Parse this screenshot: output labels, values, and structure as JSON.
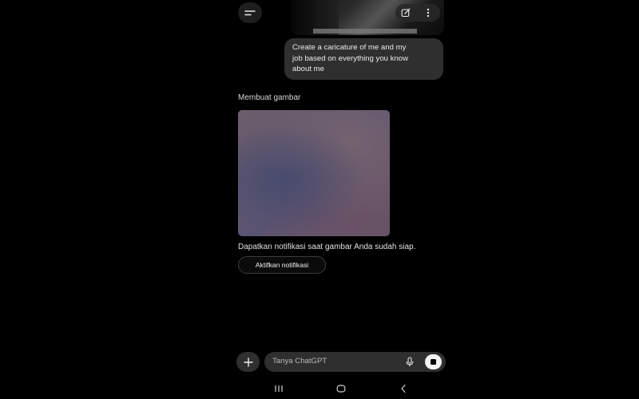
{
  "header": {
    "menu_icon": "menu-icon"
  },
  "user_message": {
    "image_actions": {
      "edit_icon": "edit-icon",
      "more_icon": "more-vertical-icon"
    },
    "lines": [
      "Create a caricature of me and my",
      "job based on everything you know",
      "about me"
    ]
  },
  "assistant": {
    "status_label": "Membuat gambar",
    "notify_text": "Dapatkan notifikasi saat gambar Anda sudah siap.",
    "notify_button_label": "Aktifkan notifikasi"
  },
  "composer": {
    "plus_icon": "plus-icon",
    "placeholder": "Tanya ChatGPT",
    "mic_icon": "microphone-icon",
    "stop_icon": "stop-icon"
  },
  "system_nav": {
    "recents_icon": "recents-icon",
    "home_icon": "home-icon",
    "back_icon": "back-icon"
  },
  "colors": {
    "background": "#000000",
    "bubble": "#2f2f2f",
    "text": "#ececec",
    "stop_button": "#f2f2f2"
  }
}
